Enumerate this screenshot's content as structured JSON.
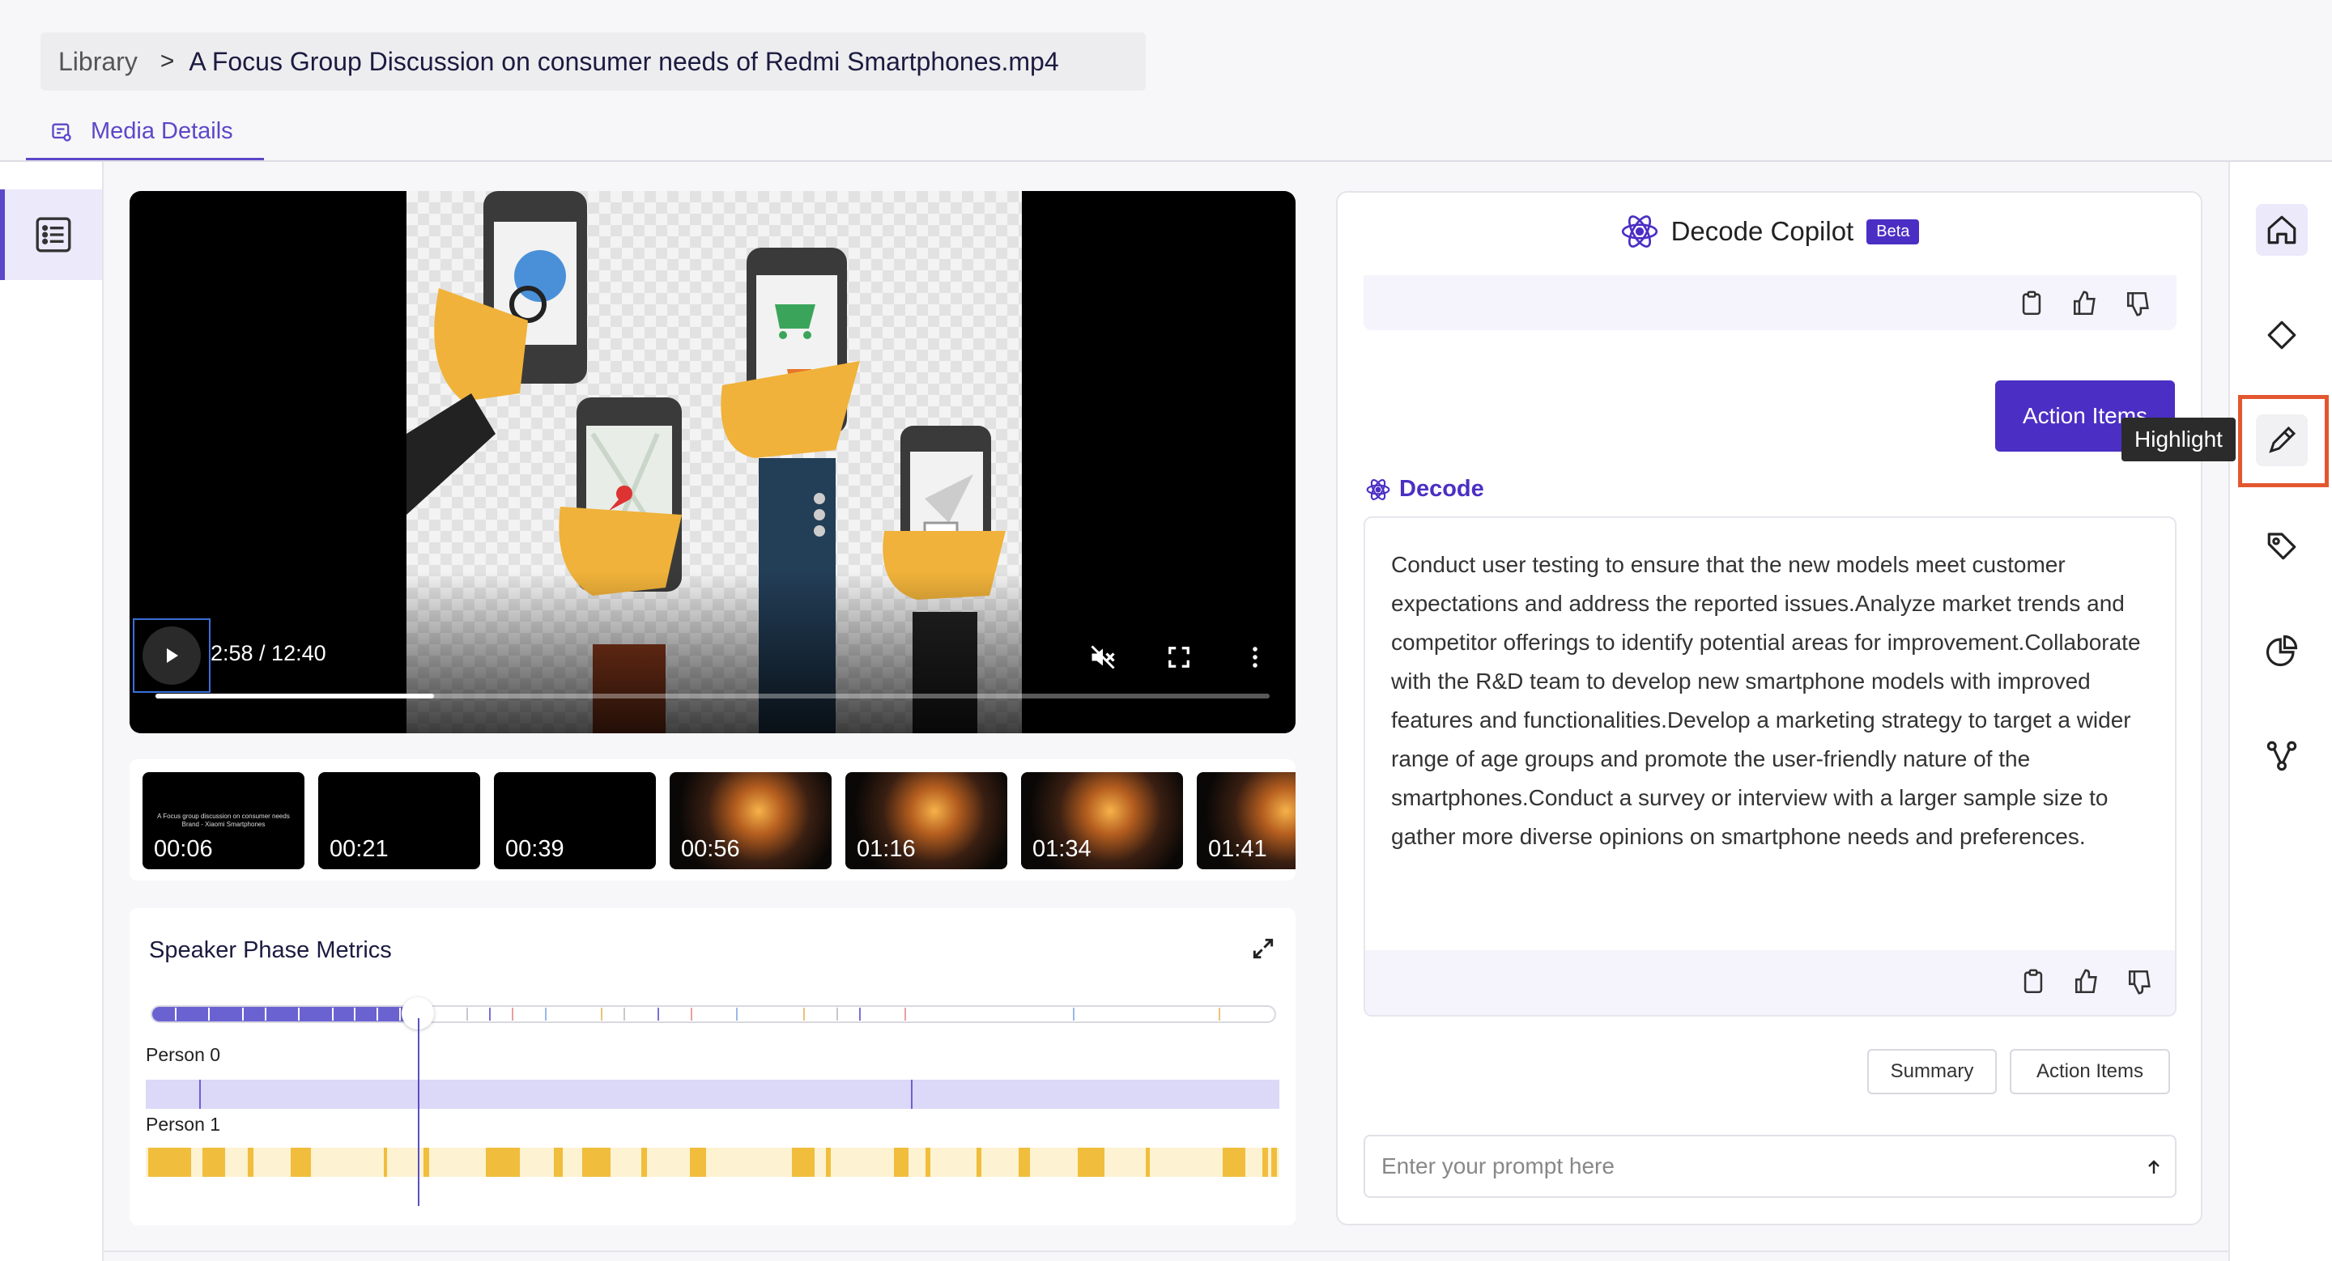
{
  "breadcrumb": {
    "library": "Library",
    "separator": ">",
    "file": "A Focus Group Discussion on consumer needs of Redmi Smartphones.mp4"
  },
  "tabs": [
    {
      "label": "Media Details",
      "icon": "media-details-icon",
      "active": true
    }
  ],
  "left_rail": {
    "icon": "list-icon"
  },
  "video": {
    "current_time": "2:58",
    "duration": "12:40",
    "time_display": "2:58 / 12:40",
    "progress": 0.25,
    "muted": true,
    "controls": [
      "play-icon",
      "mute-icon",
      "fullscreen-icon",
      "more-icon"
    ]
  },
  "thumbnails": [
    {
      "time": "00:06",
      "style": "title",
      "caption": "A Focus group discussion on consumer needs Brand - Xiaomi Smartphones"
    },
    {
      "time": "00:21",
      "style": "black"
    },
    {
      "time": "00:39",
      "style": "black"
    },
    {
      "time": "00:56",
      "style": "image"
    },
    {
      "time": "01:16",
      "style": "image"
    },
    {
      "time": "01:34",
      "style": "image"
    },
    {
      "time": "01:41",
      "style": "image"
    }
  ],
  "metrics": {
    "title": "Speaker Phase Metrics",
    "playhead": 0.236,
    "timeline_ticks": [
      0.02,
      0.05,
      0.08,
      0.1,
      0.13,
      0.16,
      0.18,
      0.2,
      0.22,
      0.28,
      0.3,
      0.32,
      0.35,
      0.4,
      0.42,
      0.45,
      0.48,
      0.52,
      0.58,
      0.61,
      0.63,
      0.67,
      0.82,
      0.95
    ],
    "speakers": [
      {
        "label": "Person 0",
        "color": "#dcd8f7",
        "marks": [
          0.047,
          0.675
        ]
      },
      {
        "label": "Person 1",
        "color": "#fdf2d2",
        "segments": [
          [
            0.002,
            0.04
          ],
          [
            0.05,
            0.07
          ],
          [
            0.09,
            0.095
          ],
          [
            0.128,
            0.146
          ],
          [
            0.21,
            0.213
          ],
          [
            0.245,
            0.25
          ],
          [
            0.3,
            0.33
          ],
          [
            0.36,
            0.368
          ],
          [
            0.385,
            0.41
          ],
          [
            0.437,
            0.442
          ],
          [
            0.48,
            0.494
          ],
          [
            0.57,
            0.59
          ],
          [
            0.6,
            0.604
          ],
          [
            0.66,
            0.673
          ],
          [
            0.688,
            0.692
          ],
          [
            0.733,
            0.737
          ],
          [
            0.77,
            0.78
          ],
          [
            0.822,
            0.846
          ],
          [
            0.882,
            0.886
          ],
          [
            0.95,
            0.97
          ],
          [
            0.985,
            0.99
          ],
          [
            0.993,
            0.998
          ]
        ]
      }
    ]
  },
  "copilot": {
    "title": "Decode Copilot",
    "badge": "Beta",
    "user_message": "Action Items",
    "assistant_name": "Decode",
    "answer": "Conduct user testing to ensure that the new models meet customer expectations and address the reported issues.Analyze market trends and competitor offerings to identify potential areas for improvement.Collaborate with the R&D team to develop new smartphone models with improved features and functionalities.Develop a marketing strategy to target a wider range of age groups and promote the user-friendly nature of the smartphones.Conduct a survey or interview with a larger sample size to gather more diverse opinions on smartphone needs and preferences.",
    "feedback_icons": [
      "clipboard-icon",
      "thumbs-up-icon",
      "thumbs-down-icon"
    ],
    "quick_actions": [
      "Summary",
      "Action Items"
    ],
    "prompt_placeholder": "Enter your prompt here",
    "prompt_value": ""
  },
  "right_toolbar": {
    "items": [
      {
        "name": "home-icon",
        "active": true
      },
      {
        "name": "tag-outline-icon"
      },
      {
        "name": "highlight-pen-icon",
        "hovered": true
      },
      {
        "name": "tag-icon"
      },
      {
        "name": "pie-chart-icon"
      },
      {
        "name": "share-graph-icon"
      }
    ],
    "tooltip": "Highlight"
  },
  "colors": {
    "accent": "#4b2fc4",
    "tab_accent": "#5b47c9",
    "timeline_fill": "#6b62d1",
    "person0": "#dcd8f7",
    "person1_bar": "#f0be3c",
    "highlight_box": "#e2572f"
  }
}
